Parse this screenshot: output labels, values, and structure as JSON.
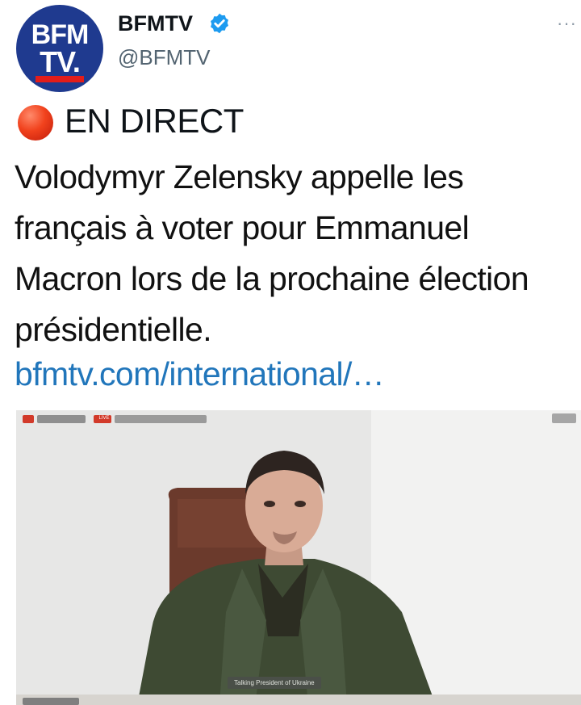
{
  "account": {
    "avatar_line1": "BFM",
    "avatar_line2": "TV.",
    "display_name": "BFMTV",
    "handle": "@BFMTV",
    "more_label": "···"
  },
  "post": {
    "live_label": "EN DIRECT",
    "text": "Volodymyr Zelensky appelle les français à voter pour Emmanuel Macron lors de la prochaine élection présidentielle.",
    "link": "bfmtv.com/international/…"
  },
  "media": {
    "live_badge": "LIVE",
    "lower_caption": "Talking President of Ukraine"
  },
  "colors": {
    "avatar_bg": "#1f3a8f",
    "verified": "#1d9bf0",
    "link": "#2176bb",
    "live_dot": "#f1421d"
  },
  "icons": {
    "verified": "verified-badge-icon",
    "more": "more-dots-icon",
    "live": "live-dot-icon"
  }
}
